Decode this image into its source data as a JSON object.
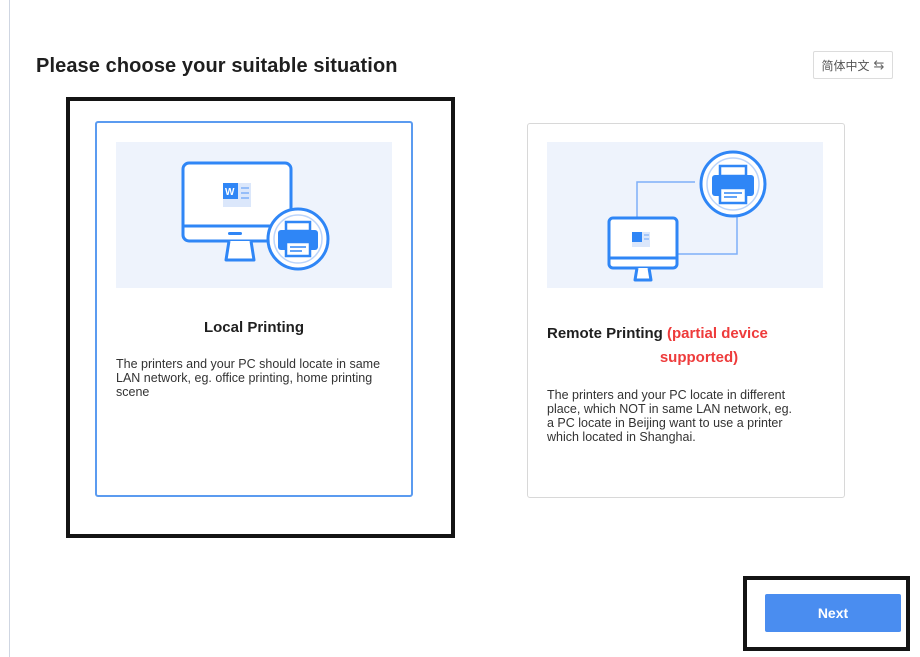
{
  "page": {
    "title": "Please choose your suitable situation"
  },
  "language_switch": {
    "label": "简体中文",
    "icon": "swap-icon"
  },
  "options": [
    {
      "id": "local",
      "selected": true,
      "title": "Local Printing",
      "description": "The printers and your PC should locate in same LAN network, eg. office printing, home printing scene",
      "illustration": "monitor-with-printer"
    },
    {
      "id": "remote",
      "selected": false,
      "title": "Remote Printing",
      "title_note_line1": "(partial device",
      "title_note_line2": "supported)",
      "description": "The printers and your PC locate in different place, which NOT in same LAN network, eg. a PC locate in Beijing want to use a printer which located in Shanghai.",
      "illustration": "monitor-connected-to-remote-printer"
    }
  ],
  "footer": {
    "next_label": "Next"
  },
  "colors": {
    "accent": "#4a8df0",
    "selected_border": "#5b9bf0",
    "note_red": "#ee3b3b",
    "illustration_bg": "#eef3fc",
    "highlight_frame": "#141414"
  }
}
